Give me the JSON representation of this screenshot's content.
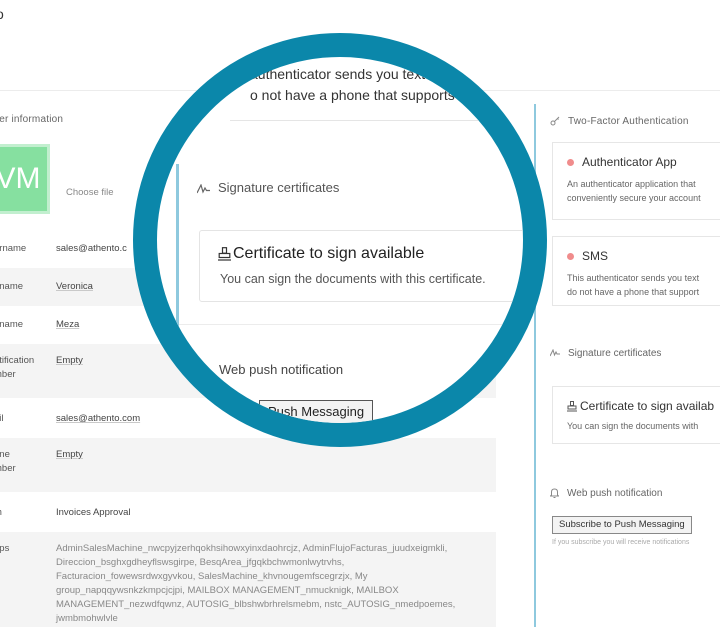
{
  "header": {
    "top_mark": "o"
  },
  "user_info": {
    "section_title": "ser information",
    "avatar_initials": "VM",
    "choose_file": "Choose file",
    "fields": [
      {
        "label": "ername",
        "value": "sales@athento.c"
      },
      {
        "label": "t name",
        "value": "Veronica"
      },
      {
        "label": "t name",
        "value": "Meza"
      },
      {
        "label": "ntification\nmber",
        "value": "Empty"
      },
      {
        "label": "ail",
        "value": "sales@athento.com"
      },
      {
        "label": "one\nmber",
        "value": "Empty"
      },
      {
        "label": "m",
        "value": "Invoices Approval"
      },
      {
        "label": "ups",
        "value": "AdminSalesMachine_nwcpyjzerhqokhsihowxyinxdaohrcjz, AdminFlujoFacturas_juudxeigmkli, Direccion_bsghxgdheyflswsgirpe, BesqArea_jfgqkbchwmonlwytrvhs, Facturacion_fowewsrdwxgyvkou, SalesMachine_khvnougemfscegrzjx, My group_napqqywsnkzkmpcjcjpi, MAILBOX MANAGEMENT_nmucknigk, MAILBOX MANAGEMENT_nezwdfqwnz, AUTOSIG_blbshwbrhrelsmebm, nstc_AUTOSIG_nmedpoemes, jwmbmohwlvle"
      }
    ]
  },
  "two_factor": {
    "section_title": "Two-Factor Authentication",
    "methods": [
      {
        "title": "Authenticator App",
        "desc_line1": "An authenticator application that",
        "desc_line2": "conveniently secure your account"
      },
      {
        "title": "SMS",
        "desc_line1": "This authenticator sends you text",
        "desc_line2": "do not have a phone that support"
      }
    ]
  },
  "signature": {
    "section_title": "Signature certificates",
    "card_title": "Certificate to sign available",
    "card_title_cut": "Certificate to sign availab",
    "card_desc": "You can sign the documents with this certificate.",
    "card_desc_cut": "You can sign the documents with"
  },
  "web_push": {
    "section_title": "Web push notification",
    "button_label": "Subscribe to Push Messaging",
    "button_label_cut": "Push Messaging",
    "note": "If you subscribe you will receive notifications"
  },
  "magnifier": {
    "top_line1": "authenticator sends you text m",
    "top_line2": "o not have a phone that supports an au"
  },
  "colors": {
    "accent": "#0b87aa",
    "panel_border": "#8ec9de",
    "avatar": "#86e0a0",
    "status_dot": "#f08c8c"
  }
}
